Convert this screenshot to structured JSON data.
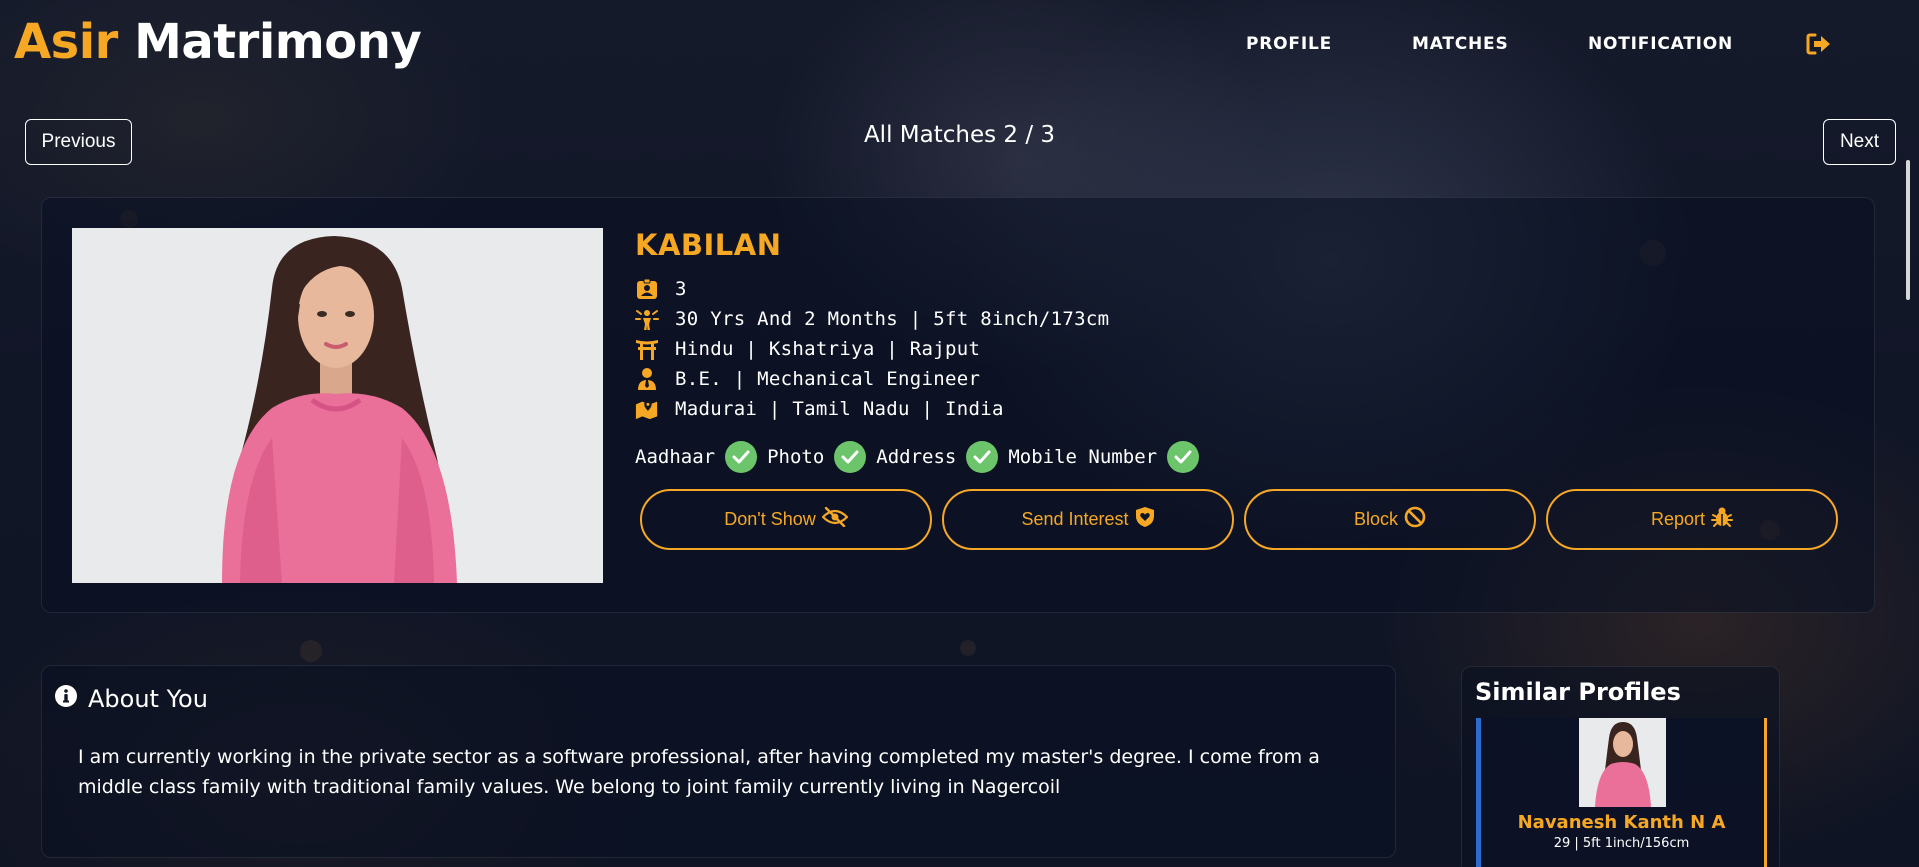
{
  "header": {
    "brand_part1": "Asir",
    "brand_part2": "Matrimony",
    "nav": [
      "PROFILE",
      "MATCHES",
      "NOTIFICATION"
    ],
    "logout_icon": "sign-out-icon"
  },
  "pager": {
    "previous_label": "Previous",
    "next_label": "Next",
    "title": "All Matches 2 / 3"
  },
  "profile": {
    "name": "KABILAN",
    "details": [
      {
        "icon": "id-badge-icon",
        "text": "3"
      },
      {
        "icon": "person-rays-icon",
        "text": "30 Yrs And 2 Months | 5ft 8inch/173cm"
      },
      {
        "icon": "torii-gate-icon",
        "text": "Hindu | Kshatriya | Rajput"
      },
      {
        "icon": "user-tie-icon",
        "text": "B.E. | Mechanical Engineer"
      },
      {
        "icon": "map-location-icon",
        "text": "Madurai | Tamil Nadu | India"
      }
    ],
    "verifications": [
      "Aadhaar",
      "Photo",
      "Address",
      "Mobile Number"
    ],
    "actions": [
      {
        "label": "Don't Show",
        "icon": "eye-slash-icon"
      },
      {
        "label": "Send Interest",
        "icon": "shield-heart-icon"
      },
      {
        "label": "Block",
        "icon": "ban-icon"
      },
      {
        "label": "Report",
        "icon": "bug-icon"
      }
    ]
  },
  "about": {
    "title": "About You",
    "text": "I am currently working in the private sector as a software professional, after having completed my master's degree. I come from a middle class family with traditional family values. We belong to joint family currently living in Nagercoil"
  },
  "similar": {
    "title": "Similar Profiles",
    "items": [
      {
        "name": "Navanesh Kanth N A",
        "meta": "29 | 5ft 1inch/156cm"
      }
    ]
  },
  "colors": {
    "accent": "#f6a825",
    "verified": "#6cc56a",
    "background": "#111627"
  }
}
